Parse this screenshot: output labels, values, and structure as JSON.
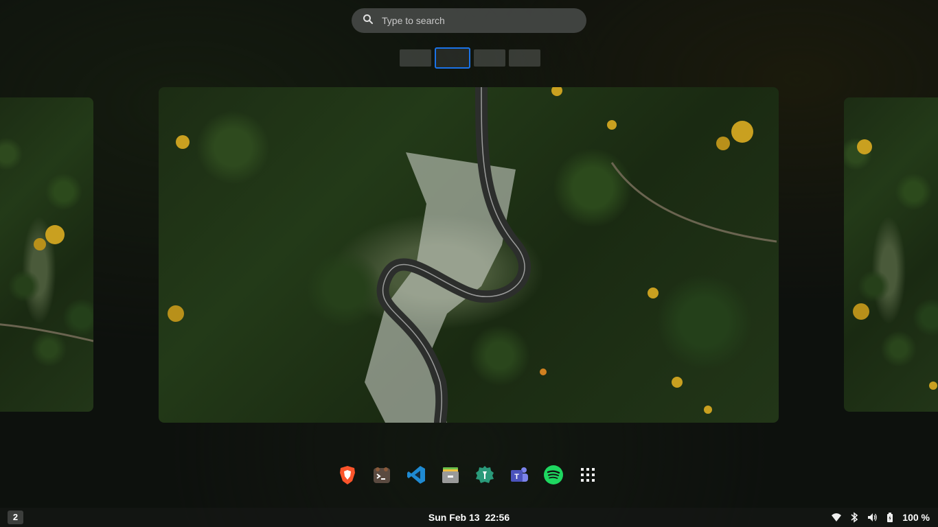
{
  "search": {
    "placeholder": "Type to search",
    "icon": "search-icon"
  },
  "workspaces": {
    "count": 4,
    "active_index": 1
  },
  "windows": [
    {
      "name": "left-window-preview",
      "content": "forest road wallpaper"
    },
    {
      "name": "center-window-preview",
      "content": "forest road wallpaper"
    },
    {
      "name": "right-window-preview",
      "content": "forest road wallpaper"
    }
  ],
  "dock": {
    "apps": [
      {
        "name": "brave-browser",
        "icon": "brave-icon"
      },
      {
        "name": "terminal",
        "icon": "terminal-icon"
      },
      {
        "name": "visual-studio-code",
        "icon": "vscode-icon"
      },
      {
        "name": "files",
        "icon": "files-icon"
      },
      {
        "name": "tweaks",
        "icon": "tweaks-icon"
      },
      {
        "name": "microsoft-teams",
        "icon": "teams-icon"
      },
      {
        "name": "spotify",
        "icon": "spotify-icon"
      },
      {
        "name": "show-applications",
        "icon": "app-grid-icon"
      }
    ]
  },
  "panel": {
    "workspace_number": "2",
    "clock": "Sun Feb 13  22:56",
    "battery_percent": "100 %",
    "tray_icons": [
      "wifi-icon",
      "bluetooth-icon",
      "volume-icon",
      "battery-icon"
    ]
  },
  "colors": {
    "accent": "#1a73e8",
    "panel_bg": "#141614"
  }
}
